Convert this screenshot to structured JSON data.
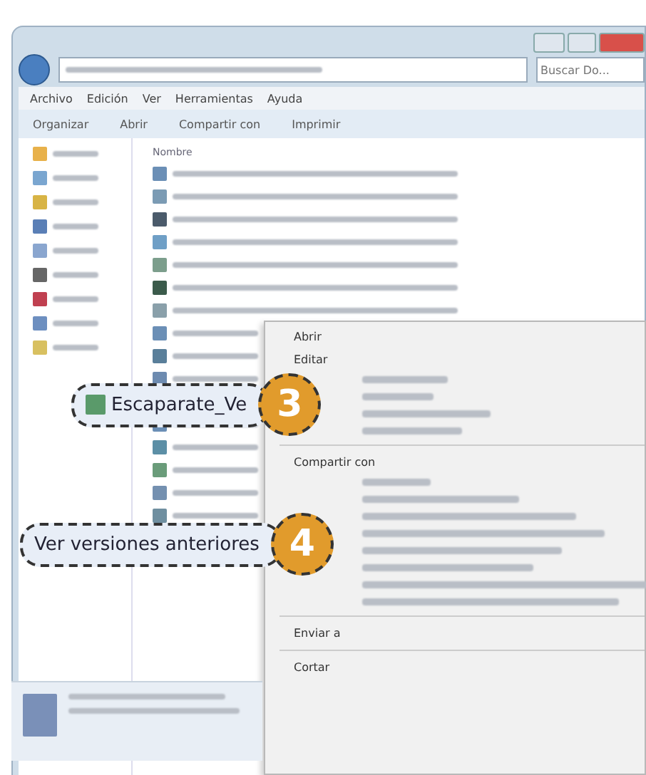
{
  "window": {
    "search_placeholder": "Buscar Do..."
  },
  "menu": [
    "Archivo",
    "Edición",
    "Ver",
    "Herramientas",
    "Ayuda"
  ],
  "toolbar": [
    "Organizar",
    "Abrir",
    "Compartir con",
    "Imprimir"
  ],
  "file_list": {
    "header": "Nombre"
  },
  "context_menu": {
    "items": [
      {
        "kind": "text",
        "label": "Abrir"
      },
      {
        "kind": "text",
        "label": "Editar"
      },
      {
        "kind": "blurred"
      },
      {
        "kind": "blurred"
      },
      {
        "kind": "blurred"
      },
      {
        "kind": "blurred"
      },
      {
        "kind": "separator"
      },
      {
        "kind": "text",
        "label": "Compartir con"
      },
      {
        "kind": "blurred"
      },
      {
        "kind": "blurred"
      },
      {
        "kind": "blurred"
      },
      {
        "kind": "blurred"
      },
      {
        "kind": "blurred"
      },
      {
        "kind": "blurred"
      },
      {
        "kind": "blurred"
      },
      {
        "kind": "blurred"
      },
      {
        "kind": "separator"
      },
      {
        "kind": "text",
        "label": "Enviar a"
      },
      {
        "kind": "separator"
      },
      {
        "kind": "text",
        "label": "Cortar"
      }
    ]
  },
  "callouts": [
    {
      "number": "3",
      "label": "Escaparate_Ve",
      "icon": true
    },
    {
      "number": "4",
      "label": "Ver versiones anteriores",
      "icon": false
    }
  ]
}
